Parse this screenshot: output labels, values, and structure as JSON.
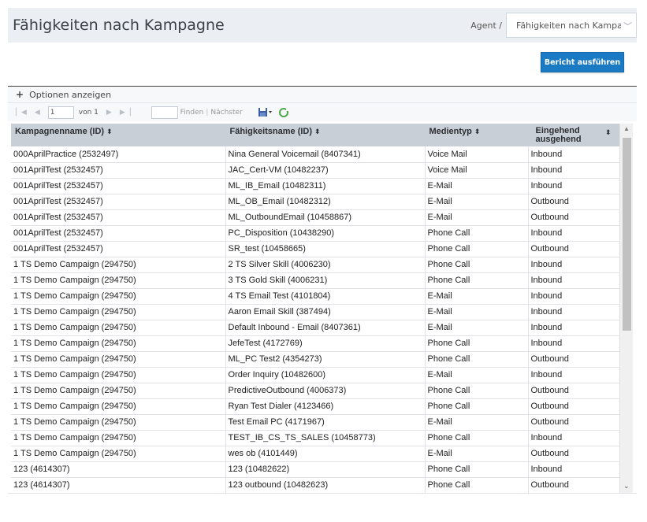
{
  "header": {
    "title": "Fähigkeiten nach Kampagne",
    "agent_label": "Agent /",
    "agent_select": "Fähigkeiten nach Kampa"
  },
  "actions": {
    "run_report": "Bericht ausführen"
  },
  "options": {
    "toggle_label": "Optionen anzeigen"
  },
  "toolbar": {
    "page_value": "1",
    "of_label": "von 1",
    "find_label": "Finden",
    "separator": "|",
    "next_label": "Nächster"
  },
  "table": {
    "columns": [
      {
        "label": "Kampagnenname (ID)",
        "sort": "⬍"
      },
      {
        "label": "Fähigkeitsname (ID)",
        "sort": "⬍"
      },
      {
        "label": "Medientyp",
        "sort": "⬍"
      },
      {
        "label": "Eingehend ausgehend",
        "sort": "⬍"
      }
    ],
    "rows": [
      [
        "000AprilPractice (2532497)",
        "Nina General Voicemail (8407341)",
        "Voice Mail",
        "Inbound"
      ],
      [
        "001AprilTest (2532457)",
        "JAC_Cert-VM (10482237)",
        "Voice Mail",
        "Inbound"
      ],
      [
        "001AprilTest (2532457)",
        "ML_IB_Email (10482311)",
        "E-Mail",
        "Inbound"
      ],
      [
        "001AprilTest (2532457)",
        "ML_OB_Email (10482312)",
        "E-Mail",
        "Outbound"
      ],
      [
        "001AprilTest (2532457)",
        "ML_OutboundEmail (10458867)",
        "E-Mail",
        "Outbound"
      ],
      [
        "001AprilTest (2532457)",
        "PC_Disposition (10438290)",
        "Phone Call",
        "Inbound"
      ],
      [
        "001AprilTest (2532457)",
        "SR_test (10458665)",
        "Phone Call",
        "Outbound"
      ],
      [
        "1 TS Demo Campaign (294750)",
        "2 TS Silver Skill (4006230)",
        "Phone Call",
        "Inbound"
      ],
      [
        "1 TS Demo Campaign (294750)",
        "3 TS Gold Skill (4006231)",
        "Phone Call",
        "Inbound"
      ],
      [
        "1 TS Demo Campaign (294750)",
        "4 TS Email Test (4101804)",
        "E-Mail",
        "Inbound"
      ],
      [
        "1 TS Demo Campaign (294750)",
        "Aaron Email Skill (387494)",
        "E-Mail",
        "Inbound"
      ],
      [
        "1 TS Demo Campaign (294750)",
        "Default Inbound - Email (8407361)",
        "E-Mail",
        "Inbound"
      ],
      [
        "1 TS Demo Campaign (294750)",
        "JefeTest (4172769)",
        "Phone Call",
        "Inbound"
      ],
      [
        "1 TS Demo Campaign (294750)",
        "ML_PC Test2 (4354273)",
        "Phone Call",
        "Outbound"
      ],
      [
        "1 TS Demo Campaign (294750)",
        "Order Inquiry (10482600)",
        "E-Mail",
        "Inbound"
      ],
      [
        "1 TS Demo Campaign (294750)",
        "PredictiveOutbound (4006373)",
        "Phone Call",
        "Outbound"
      ],
      [
        "1 TS Demo Campaign (294750)",
        "Ryan Test Dialer (4123466)",
        "Phone Call",
        "Outbound"
      ],
      [
        "1 TS Demo Campaign (294750)",
        "Test Email PC (4171967)",
        "E-Mail",
        "Outbound"
      ],
      [
        "1 TS Demo Campaign (294750)",
        "TEST_IB_CS_TS_SALES (10458773)",
        "Phone Call",
        "Inbound"
      ],
      [
        "1 TS Demo Campaign (294750)",
        "wes ob (4101449)",
        "E-Mail",
        "Outbound"
      ],
      [
        "123 (4614307)",
        "123 (10482622)",
        "Phone Call",
        "Inbound"
      ],
      [
        "123 (4614307)",
        "123 outbound (10482623)",
        "Phone Call",
        "Outbound"
      ]
    ]
  },
  "colors": {
    "header_bg": "#ebeff4",
    "accent": "#1a7bc4",
    "table_header_bg": "#c9cfd6"
  }
}
